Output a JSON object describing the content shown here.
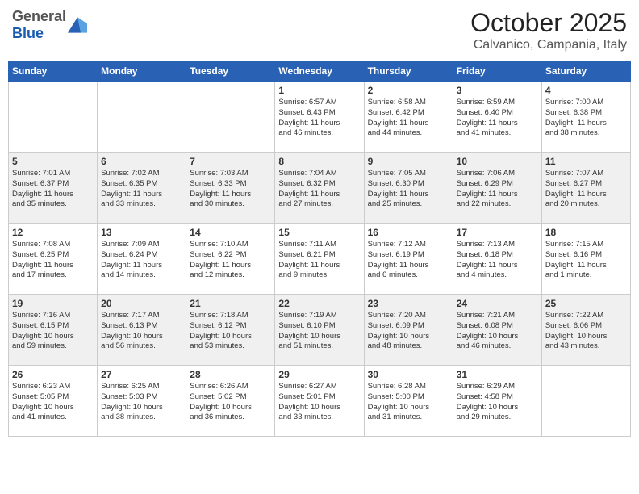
{
  "header": {
    "logo_general": "General",
    "logo_blue": "Blue",
    "month": "October 2025",
    "location": "Calvanico, Campania, Italy"
  },
  "days": [
    "Sunday",
    "Monday",
    "Tuesday",
    "Wednesday",
    "Thursday",
    "Friday",
    "Saturday"
  ],
  "weeks": [
    [
      {
        "date": "",
        "info": ""
      },
      {
        "date": "",
        "info": ""
      },
      {
        "date": "",
        "info": ""
      },
      {
        "date": "1",
        "info": "Sunrise: 6:57 AM\nSunset: 6:43 PM\nDaylight: 11 hours\nand 46 minutes."
      },
      {
        "date": "2",
        "info": "Sunrise: 6:58 AM\nSunset: 6:42 PM\nDaylight: 11 hours\nand 44 minutes."
      },
      {
        "date": "3",
        "info": "Sunrise: 6:59 AM\nSunset: 6:40 PM\nDaylight: 11 hours\nand 41 minutes."
      },
      {
        "date": "4",
        "info": "Sunrise: 7:00 AM\nSunset: 6:38 PM\nDaylight: 11 hours\nand 38 minutes."
      }
    ],
    [
      {
        "date": "5",
        "info": "Sunrise: 7:01 AM\nSunset: 6:37 PM\nDaylight: 11 hours\nand 35 minutes."
      },
      {
        "date": "6",
        "info": "Sunrise: 7:02 AM\nSunset: 6:35 PM\nDaylight: 11 hours\nand 33 minutes."
      },
      {
        "date": "7",
        "info": "Sunrise: 7:03 AM\nSunset: 6:33 PM\nDaylight: 11 hours\nand 30 minutes."
      },
      {
        "date": "8",
        "info": "Sunrise: 7:04 AM\nSunset: 6:32 PM\nDaylight: 11 hours\nand 27 minutes."
      },
      {
        "date": "9",
        "info": "Sunrise: 7:05 AM\nSunset: 6:30 PM\nDaylight: 11 hours\nand 25 minutes."
      },
      {
        "date": "10",
        "info": "Sunrise: 7:06 AM\nSunset: 6:29 PM\nDaylight: 11 hours\nand 22 minutes."
      },
      {
        "date": "11",
        "info": "Sunrise: 7:07 AM\nSunset: 6:27 PM\nDaylight: 11 hours\nand 20 minutes."
      }
    ],
    [
      {
        "date": "12",
        "info": "Sunrise: 7:08 AM\nSunset: 6:25 PM\nDaylight: 11 hours\nand 17 minutes."
      },
      {
        "date": "13",
        "info": "Sunrise: 7:09 AM\nSunset: 6:24 PM\nDaylight: 11 hours\nand 14 minutes."
      },
      {
        "date": "14",
        "info": "Sunrise: 7:10 AM\nSunset: 6:22 PM\nDaylight: 11 hours\nand 12 minutes."
      },
      {
        "date": "15",
        "info": "Sunrise: 7:11 AM\nSunset: 6:21 PM\nDaylight: 11 hours\nand 9 minutes."
      },
      {
        "date": "16",
        "info": "Sunrise: 7:12 AM\nSunset: 6:19 PM\nDaylight: 11 hours\nand 6 minutes."
      },
      {
        "date": "17",
        "info": "Sunrise: 7:13 AM\nSunset: 6:18 PM\nDaylight: 11 hours\nand 4 minutes."
      },
      {
        "date": "18",
        "info": "Sunrise: 7:15 AM\nSunset: 6:16 PM\nDaylight: 11 hours\nand 1 minute."
      }
    ],
    [
      {
        "date": "19",
        "info": "Sunrise: 7:16 AM\nSunset: 6:15 PM\nDaylight: 10 hours\nand 59 minutes."
      },
      {
        "date": "20",
        "info": "Sunrise: 7:17 AM\nSunset: 6:13 PM\nDaylight: 10 hours\nand 56 minutes."
      },
      {
        "date": "21",
        "info": "Sunrise: 7:18 AM\nSunset: 6:12 PM\nDaylight: 10 hours\nand 53 minutes."
      },
      {
        "date": "22",
        "info": "Sunrise: 7:19 AM\nSunset: 6:10 PM\nDaylight: 10 hours\nand 51 minutes."
      },
      {
        "date": "23",
        "info": "Sunrise: 7:20 AM\nSunset: 6:09 PM\nDaylight: 10 hours\nand 48 minutes."
      },
      {
        "date": "24",
        "info": "Sunrise: 7:21 AM\nSunset: 6:08 PM\nDaylight: 10 hours\nand 46 minutes."
      },
      {
        "date": "25",
        "info": "Sunrise: 7:22 AM\nSunset: 6:06 PM\nDaylight: 10 hours\nand 43 minutes."
      }
    ],
    [
      {
        "date": "26",
        "info": "Sunrise: 6:23 AM\nSunset: 5:05 PM\nDaylight: 10 hours\nand 41 minutes."
      },
      {
        "date": "27",
        "info": "Sunrise: 6:25 AM\nSunset: 5:03 PM\nDaylight: 10 hours\nand 38 minutes."
      },
      {
        "date": "28",
        "info": "Sunrise: 6:26 AM\nSunset: 5:02 PM\nDaylight: 10 hours\nand 36 minutes."
      },
      {
        "date": "29",
        "info": "Sunrise: 6:27 AM\nSunset: 5:01 PM\nDaylight: 10 hours\nand 33 minutes."
      },
      {
        "date": "30",
        "info": "Sunrise: 6:28 AM\nSunset: 5:00 PM\nDaylight: 10 hours\nand 31 minutes."
      },
      {
        "date": "31",
        "info": "Sunrise: 6:29 AM\nSunset: 4:58 PM\nDaylight: 10 hours\nand 29 minutes."
      },
      {
        "date": "",
        "info": ""
      }
    ]
  ]
}
